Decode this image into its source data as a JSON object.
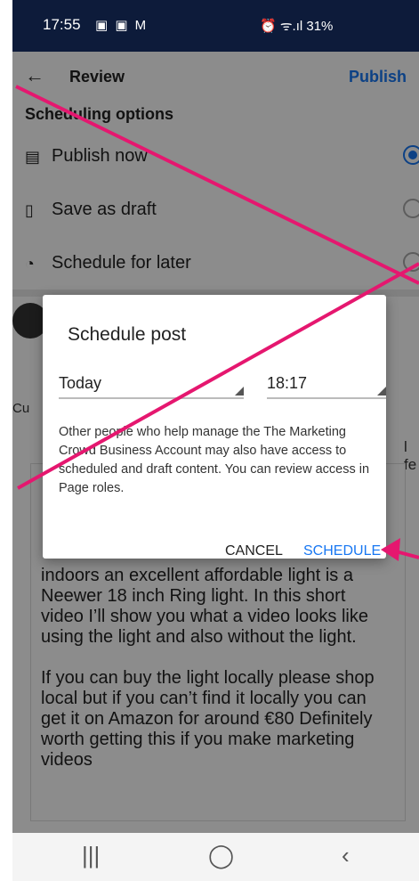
{
  "status_bar": {
    "time": "17:55",
    "left_icons": "▣ ▣ M",
    "right": "⏰ ᯤ.ıl 31%"
  },
  "app_bar": {
    "title": "Review",
    "action": "Publish"
  },
  "scheduling": {
    "heading": "Scheduling options",
    "options": [
      {
        "label": "Publish now",
        "icon": "document-icon",
        "selected": true
      },
      {
        "label": "Save as draft",
        "icon": "draft-icon",
        "selected": false
      },
      {
        "label": "Schedule for later",
        "icon": "clock-icon",
        "selected": false
      }
    ]
  },
  "post": {
    "text_lines": [
      "indoors an excellent affordable light is a",
      "Neewer 18 inch Ring light. In this short",
      "video I’ll show you what a video looks like",
      "using the light and also without the light.",
      "",
      "If you can buy the light locally please shop",
      "local but if you can’t find it locally you can",
      "get it on Amazon for around €80 Definitely",
      "worth getting this if you make marketing",
      "videos"
    ]
  },
  "dialog": {
    "title": "Schedule post",
    "date_value": "Today",
    "time_value": "18:17",
    "body": "Other people who help manage the The Marketing Crowd Business Account may also have access to scheduled and draft content. You can review access in Page roles.",
    "cancel_label": "CANCEL",
    "schedule_label": "SCHEDULE"
  },
  "peek_text": {
    "left_cu": "Cu",
    "right_fe": "l fe"
  },
  "colors": {
    "accent": "#1877f2",
    "status_bar": "#0d1b3a",
    "annotation": "#e5176f"
  }
}
